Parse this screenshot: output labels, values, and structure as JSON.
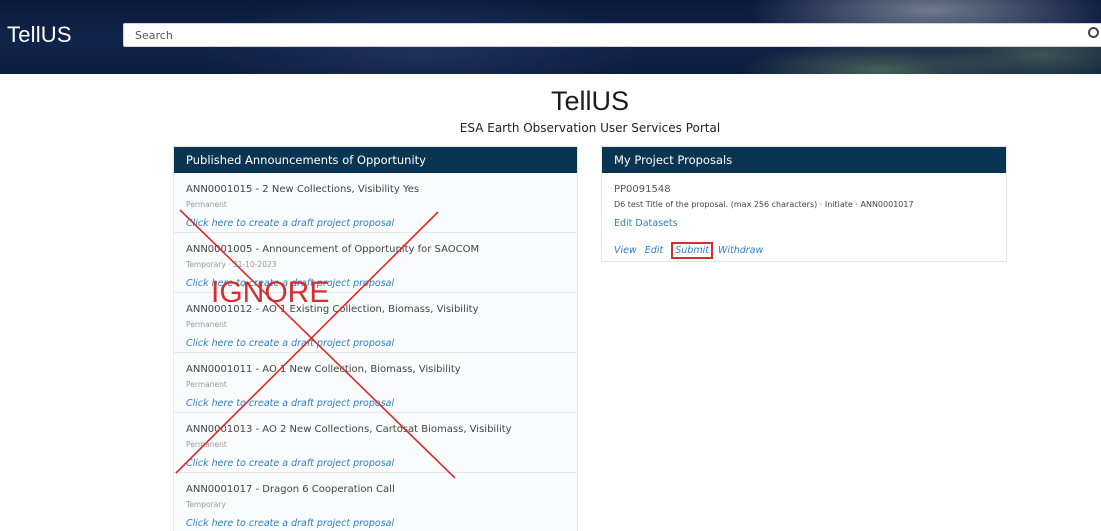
{
  "header": {
    "brand": "TellUS",
    "search_placeholder": "Search"
  },
  "page": {
    "title": "TellUS",
    "subtitle": "ESA Earth Observation User Services Portal"
  },
  "announcements": {
    "heading": "Published Announcements of Opportunity",
    "items": [
      {
        "title": "ANN0001015 - 2 New Collections, Visibility Yes",
        "type": "Permanent",
        "link": "Click here to create a draft project proposal"
      },
      {
        "title": "ANN0001005 - Announcement of Opportunity for SAOCOM",
        "type": "Temporary · 31-10-2023",
        "link": "Click here to create a draft project proposal"
      },
      {
        "title": "ANN0001012 - AO 1 Existing Collection, Biomass, Visibility",
        "type": "Permanent",
        "link": "Click here to create a draft project proposal"
      },
      {
        "title": "ANN0001011 - AO 1 New Collection, Biomass, Visibility",
        "type": "Permanent",
        "link": "Click here to create a draft project proposal"
      },
      {
        "title": "ANN0001013 - AO 2 New Collections, Cartosat Biomass, Visibility",
        "type": "Permanent",
        "link": "Click here to create a draft project proposal"
      },
      {
        "title": "ANN0001017 - Dragon 6 Cooperation Call",
        "type": "Temporary",
        "link": "Click here to create a draft project proposal"
      }
    ]
  },
  "proposals": {
    "heading": "My Project Proposals",
    "item": {
      "id": "PP0091548",
      "description": "D6 test Title of the proposal. (max 256 characters) · Initiate · ANN0001017",
      "edit_datasets": "Edit Datasets",
      "actions": {
        "view": "View",
        "edit": "Edit",
        "submit": "Submit",
        "withdraw": "Withdraw"
      }
    }
  },
  "annotation": {
    "label": "IGNORE",
    "color": "#d32f2f"
  }
}
